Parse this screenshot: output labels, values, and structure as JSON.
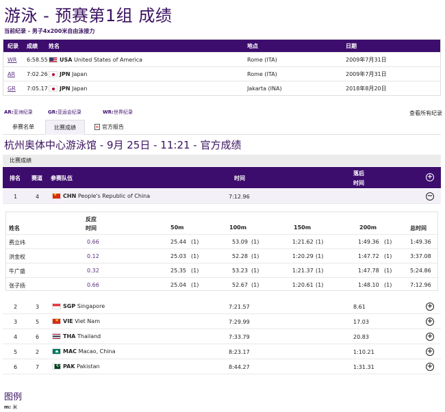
{
  "page": {
    "title": "游泳 - 预赛第1组 成绩",
    "subtitle": "当前纪录 - 男子4x200米自由泳接力"
  },
  "records": {
    "headers": [
      "纪录",
      "成绩",
      "姓名",
      "地点",
      "日期"
    ],
    "rows": [
      {
        "code": "WR",
        "time": "6:58.55",
        "flag": "usa",
        "noc": "USA",
        "name": "United States of America",
        "place": "Rome (ITA)",
        "date": "2009年7月31日"
      },
      {
        "code": "AR",
        "time": "7:02.26",
        "flag": "jpn",
        "noc": "JPN",
        "name": "Japan",
        "place": "Rome (ITA)",
        "date": "2009年7月31日"
      },
      {
        "code": "GR",
        "time": "7:05.17",
        "flag": "jpn",
        "noc": "JPN",
        "name": "Japan",
        "place": "Jakarta (INA)",
        "date": "2018年8月20日"
      }
    ]
  },
  "legend": {
    "ar_code": "AR:",
    "ar_text": "亚洲纪录",
    "gr_code": "GR:",
    "gr_text": "亚运会纪录",
    "wr_code": "WR:",
    "wr_text": "世界纪录",
    "view_all": "查看所有纪录"
  },
  "tabs": {
    "entries": "参赛名单",
    "results": "比赛成绩",
    "report": "官方报告"
  },
  "venue": "杭州奥体中心游泳馆 - 9月 25日 - 11:21 - 官方成绩",
  "section_label": "比赛成绩",
  "results": {
    "headers": {
      "rank": "排名",
      "lane": "赛道",
      "team": "参赛队伍",
      "time": "时间",
      "behind_1": "落后",
      "behind_2": "时间"
    },
    "expanded": {
      "rank": "1",
      "lane": "4",
      "flag": "chn",
      "noc": "CHN",
      "name": "People's Republic of China",
      "time": "7:12.96",
      "behind": ""
    },
    "rows": [
      {
        "rank": "2",
        "lane": "3",
        "flag": "sgp",
        "noc": "SGP",
        "name": "Singapore",
        "time": "7:21.57",
        "behind": "8.61"
      },
      {
        "rank": "3",
        "lane": "5",
        "flag": "vie",
        "noc": "VIE",
        "name": "Viet Nam",
        "time": "7:29.99",
        "behind": "17.03"
      },
      {
        "rank": "4",
        "lane": "6",
        "flag": "tha",
        "noc": "THA",
        "name": "Thailand",
        "time": "7:33.79",
        "behind": "20.83"
      },
      {
        "rank": "5",
        "lane": "2",
        "flag": "mac",
        "noc": "MAC",
        "name": "Macao, China",
        "time": "8:23.17",
        "behind": "1:10.21"
      },
      {
        "rank": "6",
        "lane": "7",
        "flag": "pak",
        "noc": "PAK",
        "name": "Pakistan",
        "time": "8:44.27",
        "behind": "1:31.31"
      }
    ]
  },
  "splits": {
    "headers": {
      "name": "姓名",
      "reaction_1": "反应",
      "reaction_2": "时间",
      "m50": "50m",
      "m100": "100m",
      "m150": "150m",
      "m200": "200m",
      "total": "总时间"
    },
    "rows": [
      {
        "name": "费立纬",
        "reaction": "0.66",
        "m50": "25.44",
        "r50": "(1)",
        "m100": "53.09",
        "r100": "(1)",
        "m150": "1:21.62",
        "r150": "(1)",
        "m200": "1:49.36",
        "r200": "(1)",
        "total": "1:49.36"
      },
      {
        "name": "洪金权",
        "reaction": "0.12",
        "m50": "25.03",
        "r50": "(1)",
        "m100": "52.28",
        "r100": "(1)",
        "m150": "1:20.29",
        "r150": "(1)",
        "m200": "1:47.72",
        "r200": "(1)",
        "total": "3:37.08"
      },
      {
        "name": "牛广盛",
        "reaction": "0.32",
        "m50": "25.35",
        "r50": "(1)",
        "m100": "53.23",
        "r100": "(1)",
        "m150": "1:21.37",
        "r150": "(1)",
        "m200": "1:47.78",
        "r200": "(1)",
        "total": "5:24.86"
      },
      {
        "name": "张子扬",
        "reaction": "0.66",
        "m50": "25.04",
        "r50": "(1)",
        "m100": "52.67",
        "r100": "(1)",
        "m150": "1:20.61",
        "r150": "(1)",
        "m200": "1:48.10",
        "r200": "(1)",
        "total": "7:12.96"
      }
    ]
  },
  "footer": {
    "title": "图例",
    "note_code": "m:",
    "note_text": "米"
  }
}
